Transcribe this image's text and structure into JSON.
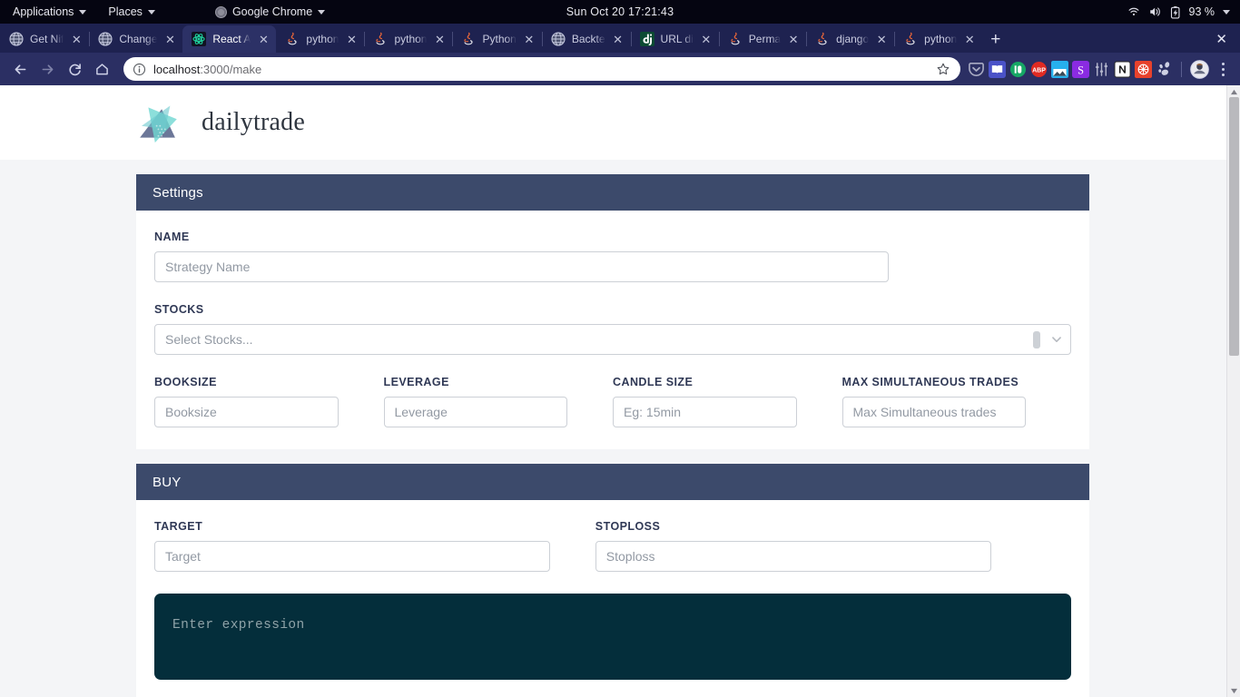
{
  "os_bar": {
    "applications": "Applications",
    "places": "Places",
    "active_app": "Google Chrome",
    "clock": "Sun Oct 20  17:21:43",
    "battery": "93 %",
    "icons": [
      "wifi-icon",
      "volume-icon",
      "battery-icon",
      "caret-down-icon"
    ]
  },
  "browser": {
    "tabs": [
      {
        "title": "Get Nif",
        "favicon": "globe-icon",
        "active": false
      },
      {
        "title": "Change",
        "favicon": "globe-icon",
        "active": false
      },
      {
        "title": "React A",
        "favicon": "react-icon",
        "active": true
      },
      {
        "title": "python",
        "favicon": "java-icon",
        "active": false
      },
      {
        "title": "python",
        "favicon": "java-icon",
        "active": false
      },
      {
        "title": "Python",
        "favicon": "java-icon",
        "active": false
      },
      {
        "title": "Backte",
        "favicon": "globe-icon",
        "active": false
      },
      {
        "title": "URL di",
        "favicon": "django-icon",
        "active": false
      },
      {
        "title": "Perma",
        "favicon": "java-icon",
        "active": false
      },
      {
        "title": "django",
        "favicon": "java-icon",
        "active": false
      },
      {
        "title": "python",
        "favicon": "java-icon",
        "active": false
      }
    ],
    "tab_close_label": "✕",
    "new_tab_label": "+",
    "window_close_label": "✕",
    "nav": {
      "back": "back-arrow-icon",
      "forward": "forward-arrow-icon",
      "reload": "reload-icon",
      "home": "home-icon"
    },
    "omnibox": {
      "host": "localhost",
      "path": ":3000/make",
      "full_url": "localhost:3000/make",
      "info_icon": "site-info-icon",
      "star_icon": "bookmark-star-icon"
    },
    "extensions": [
      "pocket-icon",
      "dictionary-icon",
      "pushbullet-icon",
      "adblock-plus-icon",
      "screenshot-icon",
      "s-extension-icon",
      "sliders-icon",
      "notion-icon",
      "redmine-icon",
      "gnome-icon"
    ],
    "profile_icon": "profile-avatar-icon",
    "menu_icon": "kebab-menu-icon"
  },
  "page": {
    "brand": {
      "name": "dailytrade",
      "logo": "dailytrade-logo-icon"
    },
    "settings": {
      "heading": "Settings",
      "name": {
        "label": "NAME",
        "placeholder": "Strategy Name",
        "value": ""
      },
      "stocks": {
        "label": "STOCKS",
        "placeholder": "Select Stocks...",
        "value": ""
      },
      "booksize": {
        "label": "BOOKSIZE",
        "placeholder": "Booksize",
        "value": ""
      },
      "leverage": {
        "label": "LEVERAGE",
        "placeholder": "Leverage",
        "value": ""
      },
      "candle_size": {
        "label": "CANDLE SIZE",
        "placeholder": "Eg: 15min",
        "value": ""
      },
      "max_trades": {
        "label": "MAX SIMULTANEOUS TRADES",
        "placeholder": "Max Simultaneous trades",
        "value": ""
      }
    },
    "buy": {
      "heading": "BUY",
      "target": {
        "label": "TARGET",
        "placeholder": "Target",
        "value": ""
      },
      "stoploss": {
        "label": "STOPLOSS",
        "placeholder": "Stoploss",
        "value": ""
      },
      "expression": {
        "placeholder": "Enter expression",
        "value": ""
      }
    }
  },
  "colors": {
    "panel_header": "#3c4a6b",
    "page_bg": "#f4f5f7",
    "editor_bg": "#042e3b",
    "chrome_toolbar": "#2b2f63",
    "tabstrip": "#1e2250"
  }
}
